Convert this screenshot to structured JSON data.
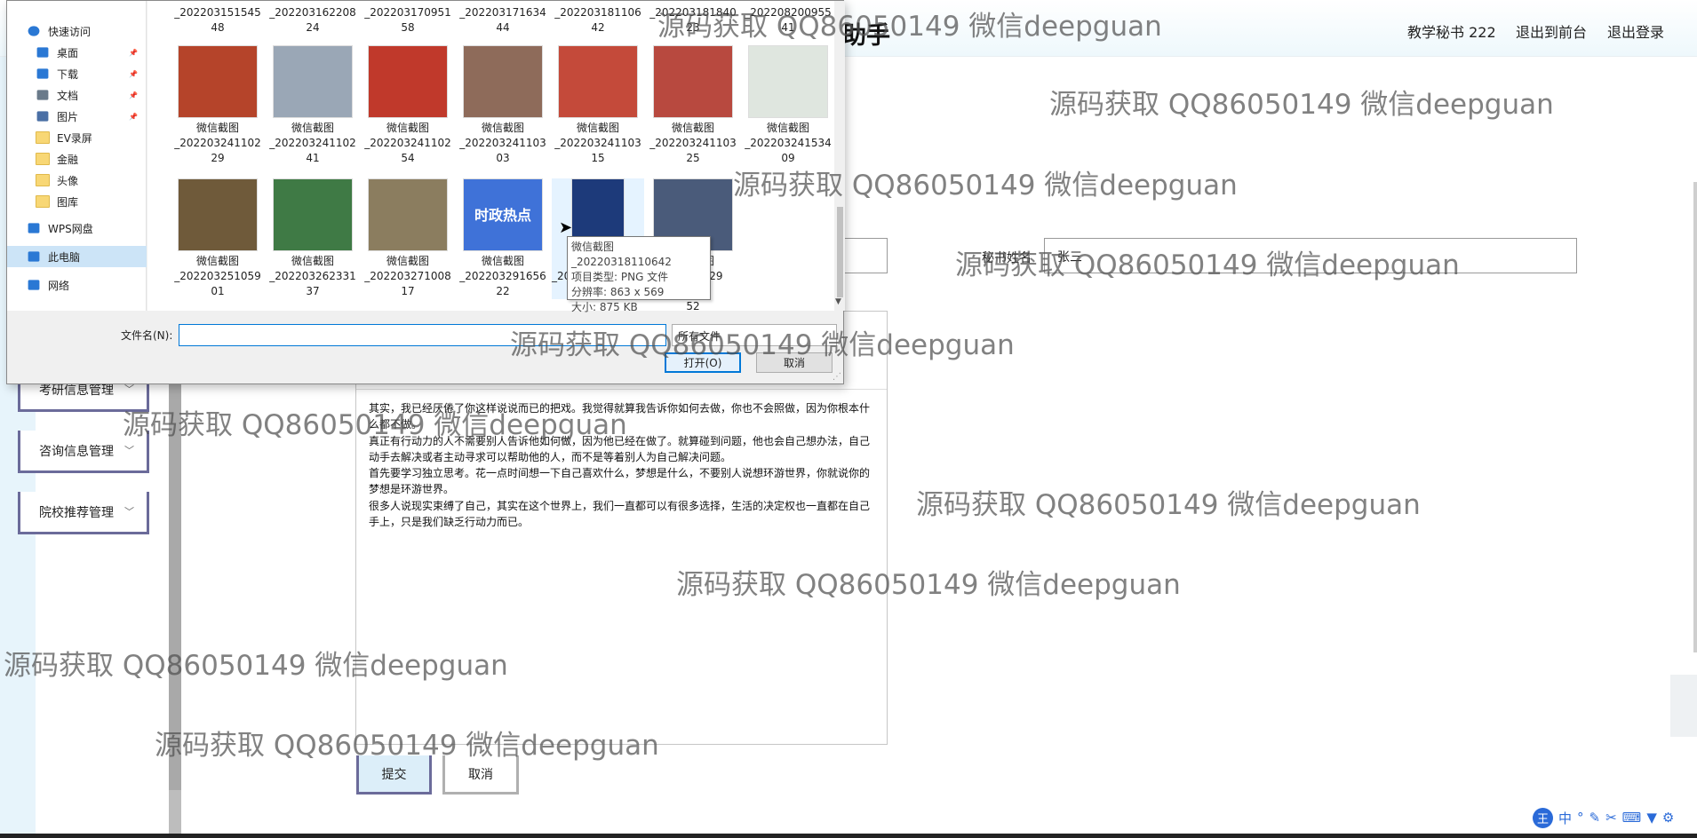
{
  "app": {
    "title": "助手",
    "user_label": "教学秘书 222",
    "back_to_front": "退出到前台",
    "logout": "退出登录"
  },
  "sidebar": {
    "items": [
      {
        "label": "考研信息管理"
      },
      {
        "label": "咨询信息管理"
      },
      {
        "label": "院校推荐管理"
      }
    ]
  },
  "form": {
    "secretary_name_label": "秘书姓名",
    "secretary_name_value": "张三",
    "content_paragraphs": [
      "其实，我已经厌倦了你这样说说而已的把戏。我觉得就算我告诉你如何去做，你也不会照做，因为你根本什么都不做。",
      "真正有行动力的人不需要别人告诉他如何做，因为他已经在做了。就算碰到问题，他也会自己想办法，自己动手去解决或者主动寻求可以帮助他的人，而不是等着别人为自己解决问题。",
      "首先要学习独立思考。花一点时间想一下自己喜欢什么，梦想是什么，不要别人说想环游世界，你就说你的梦想是环游世界。",
      "很多人说现实束缚了自己，其实在这个世界上，我们一直都可以有很多选择，生活的决定权也一直都在自己手上，只是我们缺乏行动力而已。"
    ],
    "submit_label": "提交",
    "cancel_label": "取消"
  },
  "dialog": {
    "nav": [
      {
        "label": "快速访问",
        "icon": "star-icon",
        "pinned": false
      },
      {
        "label": "桌面",
        "icon": "desktop-icon",
        "pinned": true
      },
      {
        "label": "下载",
        "icon": "download-icon",
        "pinned": true
      },
      {
        "label": "文档",
        "icon": "document-icon",
        "pinned": true
      },
      {
        "label": "图片",
        "icon": "picture-icon",
        "pinned": true
      },
      {
        "label": "EV录屏",
        "icon": "folder-icon",
        "pinned": false
      },
      {
        "label": "金融",
        "icon": "folder-icon",
        "pinned": false
      },
      {
        "label": "头像",
        "icon": "folder-icon",
        "pinned": false
      },
      {
        "label": "图库",
        "icon": "folder-icon",
        "pinned": false
      },
      {
        "label": "WPS网盘",
        "icon": "cloud-icon",
        "pinned": false
      },
      {
        "label": "此电脑",
        "icon": "computer-icon",
        "pinned": false
      },
      {
        "label": "网络",
        "icon": "network-icon",
        "pinned": false
      }
    ],
    "top_row_names": [
      "_202203151545\n48",
      "_202203162208\n24",
      "_202203170951\n58",
      "_202203171634\n44",
      "_202203181106\n42",
      "_202203181840\n23",
      "_202208200955\n41"
    ],
    "row2": [
      {
        "name": "微信截图\n_202203241102\n29",
        "color": "#b5442a"
      },
      {
        "name": "微信截图\n_202203241102\n41",
        "color": "#9aa7b6"
      },
      {
        "name": "微信截图\n_202203241102\n54",
        "color": "#c0392b"
      },
      {
        "name": "微信截图\n_202203241103\n03",
        "color": "#8e6b5a"
      },
      {
        "name": "微信截图\n_202203241103\n15",
        "color": "#c44a3a"
      },
      {
        "name": "微信截图\n_202203241103\n25",
        "color": "#b8493f"
      },
      {
        "name": "微信截图\n_202203241534\n09",
        "color": "#dfe6df"
      }
    ],
    "row3": [
      {
        "name": "微信截图\n_202203251059\n01",
        "color": "#6f5a3a"
      },
      {
        "name": "微信截图\n_202203262331\n37",
        "color": "#3f7a45"
      },
      {
        "name": "微信截图\n_202203271008\n17",
        "color": "#8b7d5f"
      },
      {
        "name": "微信截图\n_202203291656\n22",
        "color": "#3f72d8"
      },
      {
        "name": "微信截图\n_20220318110642\n36",
        "color": "#1d3a7a"
      },
      {
        "name": "微信截图\n_20220329\n1656\n52",
        "color": "#4a5b7a"
      }
    ],
    "thumb_text_banner": "时政热点",
    "tooltip": {
      "line1": "微信截图_20220318110642",
      "line2": "项目类型: PNG 文件",
      "line3": "分辨率: 863 x 569",
      "line4": "大小: 875 KB"
    },
    "filename_label": "文件名(N):",
    "filename_value": "",
    "filetype_value": "所有文件",
    "open_label": "打开(O)",
    "cancel_label": "取消"
  },
  "watermark_text": "源码获取 QQ86050149 微信deepguan",
  "ime": {
    "logo": "王",
    "mode": "中"
  }
}
